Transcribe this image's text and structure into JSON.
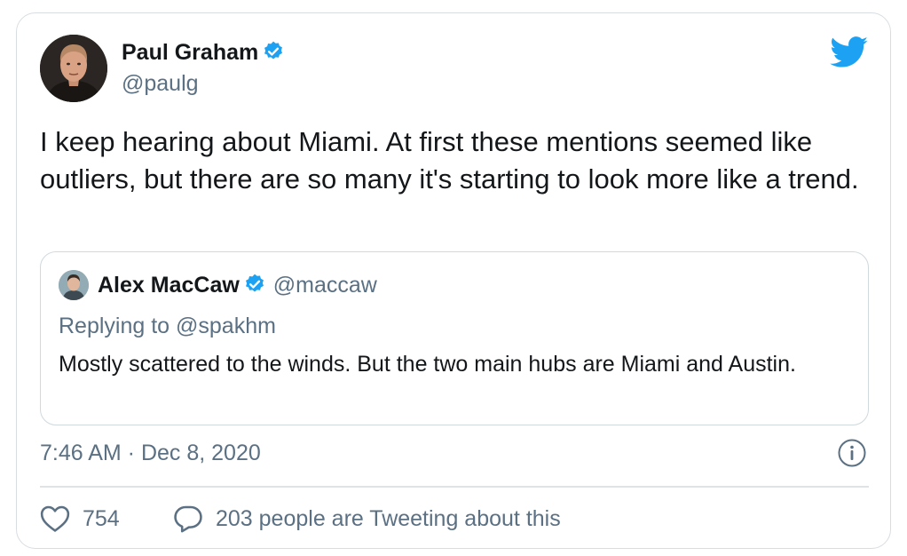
{
  "tweet": {
    "author": {
      "name": "Paul Graham",
      "handle": "@paulg",
      "verified": true
    },
    "text": "I keep hearing about Miami. At first these mentions seemed like outliers, but there are so many it's starting to look more like a trend.",
    "quoted": {
      "author_name": "Alex MacCaw",
      "author_handle": "@maccaw",
      "verified": true,
      "reply_context": "Replying to @spakhm",
      "text": "Mostly scattered to the winds. But the two main hubs are Miami and Austin."
    },
    "timestamp": "7:46 AM · Dec 8, 2020",
    "likes": "754",
    "retweet_text": "203 people are Tweeting about this"
  },
  "colors": {
    "twitter_blue": "#1da1f2",
    "secondary_text": "#5b7083",
    "primary_text": "#14171a",
    "border": "#d8dde1"
  },
  "icons": [
    "twitter-logo-icon",
    "verified-badge-icon",
    "info-icon",
    "heart-icon",
    "comment-bubble-icon"
  ]
}
